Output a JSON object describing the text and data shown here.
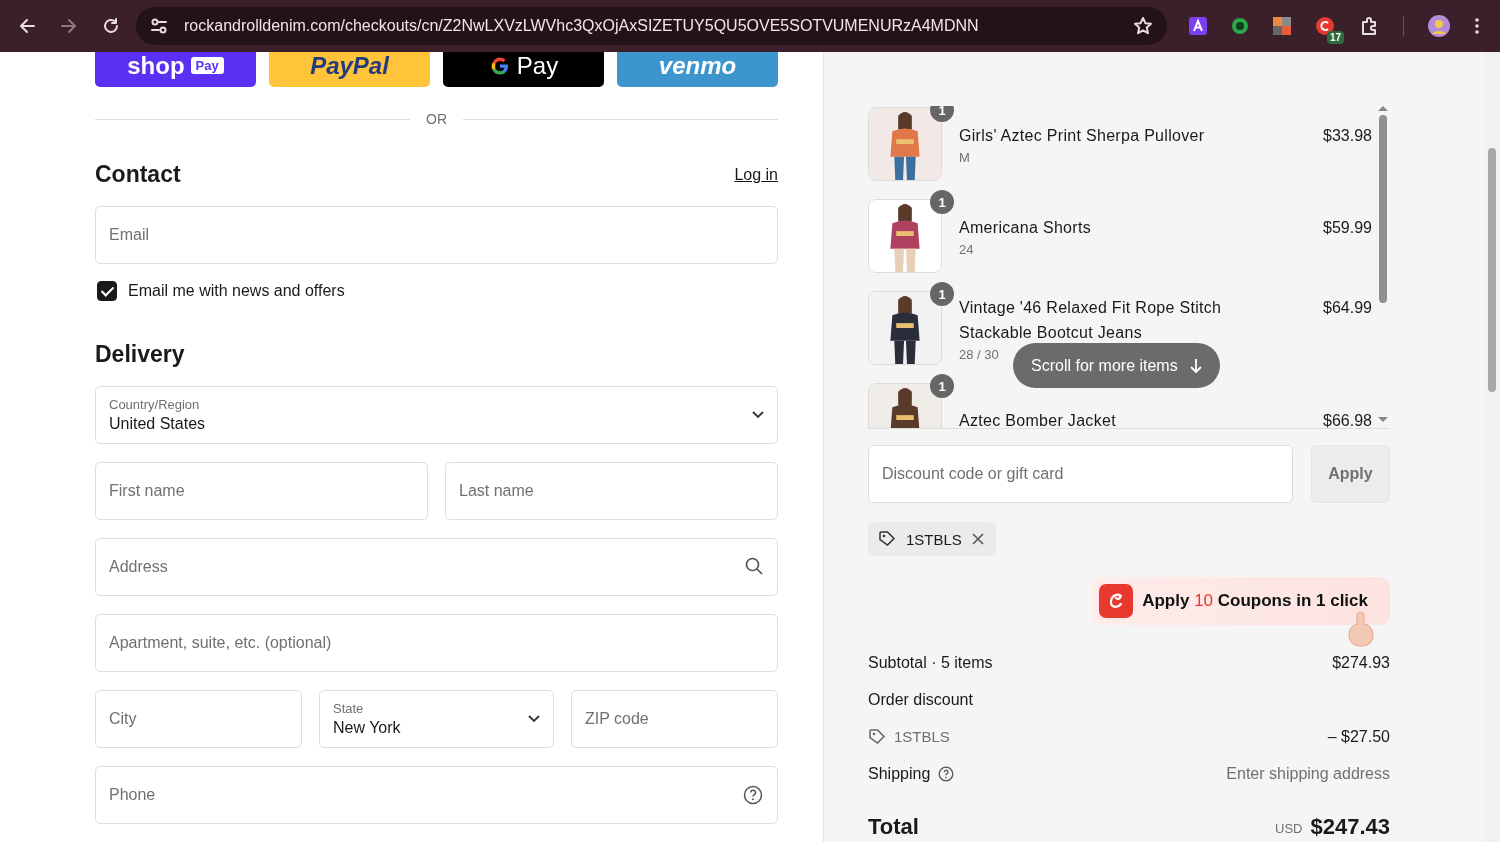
{
  "browser": {
    "url": "rockandrolldenim.com/checkouts/cn/Z2NwLXVzLWVhc3QxOjAxSIZETUY5QU5OVE5SOTVUMENURzA4MDNN",
    "extension_badge": "17"
  },
  "express_checkout": [
    {
      "kind": "shop",
      "label": "shop",
      "badge": "Pay"
    },
    {
      "kind": "paypal",
      "label": "PayPal"
    },
    {
      "kind": "gpay",
      "label": "Pay"
    },
    {
      "kind": "venmo",
      "label": "venmo"
    }
  ],
  "divider_text": "OR",
  "contact": {
    "heading": "Contact",
    "login_link": "Log in",
    "email": {
      "placeholder": "Email"
    },
    "newsletter": {
      "label": "Email me with news and offers",
      "checked": true
    }
  },
  "delivery": {
    "heading": "Delivery",
    "rows": [
      [
        {
          "kind": "select",
          "label": "Country/Region",
          "value": "United States"
        }
      ],
      [
        {
          "kind": "text",
          "placeholder": "First name"
        },
        {
          "kind": "text",
          "placeholder": "Last name"
        }
      ],
      [
        {
          "kind": "search",
          "placeholder": "Address"
        }
      ],
      [
        {
          "kind": "text",
          "placeholder": "Apartment, suite, etc. (optional)"
        }
      ],
      [
        {
          "kind": "text",
          "placeholder": "City"
        },
        {
          "kind": "select",
          "label": "State",
          "value": "New York"
        },
        {
          "kind": "text",
          "placeholder": "ZIP code"
        }
      ],
      [
        {
          "kind": "help",
          "placeholder": "Phone"
        }
      ]
    ]
  },
  "order_summary": {
    "items": [
      {
        "name": "Girls' Aztec Print Sherpa Pullover",
        "variant": "M",
        "price": "$33.98",
        "quantity": "1"
      },
      {
        "name": "Americana Shorts",
        "variant": "24",
        "price": "$59.99",
        "quantity": "1"
      },
      {
        "name": "Vintage '46 Relaxed Fit Rope Stitch Stackable Bootcut Jeans",
        "variant": "28 / 30",
        "price": "$64.99",
        "quantity": "1"
      },
      {
        "name": "Aztec Bomber Jacket",
        "price": "$66.98",
        "quantity": "1"
      }
    ],
    "scroll_hint": "Scroll for more items",
    "discount": {
      "placeholder": "Discount code or gift card",
      "button": "Apply"
    },
    "applied_codes": [
      {
        "code": "1STBLS"
      }
    ],
    "coupon_promo": {
      "before": "Apply",
      "highlight": "10",
      "after": "Coupons in 1 click"
    },
    "subtotal": {
      "label": "Subtotal · 5 items",
      "value": "$274.93"
    },
    "order_discount": {
      "label": "Order discount",
      "code": "1STBLS",
      "amount": "– $27.50"
    },
    "shipping": {
      "label": "Shipping",
      "value": "Enter shipping address"
    },
    "total": {
      "label": "Total",
      "currency": "USD",
      "value": "$247.43"
    }
  }
}
